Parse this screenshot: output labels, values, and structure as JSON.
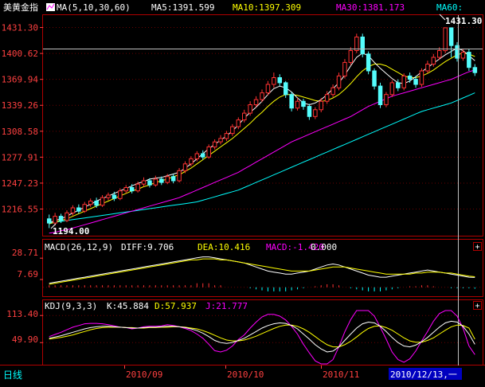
{
  "colors": {
    "background": "#000000",
    "frame": "#b00000",
    "up_candle": "#ff3232",
    "down_candle": "#54fcfc",
    "ma5": "#ffffff",
    "ma10": "#ffff00",
    "ma30": "#ff00ff",
    "ma60": "#00ffff",
    "axis_text": "#ff4040",
    "price_line": "#c0c0c0",
    "macd_pos": "#ff3232",
    "macd_neg": "#00ffff",
    "status_text": "#ffff00",
    "date_highlight": "#0000c0"
  },
  "price_panel": {
    "instrument": "美黄金指",
    "ma_header": "MA(5,10,30,60)",
    "ma5_label": "MA5:1391.599",
    "ma10_label": "MA10:1397.309",
    "ma30_label": "MA30:1381.173",
    "ma60_label": "MA60:",
    "high_marker": "1431.30",
    "low_marker": "1194.00",
    "y_ticks": [
      "1431.30",
      "1400.62",
      "1369.94",
      "1339.26",
      "1308.58",
      "1277.91",
      "1247.23",
      "1216.55"
    ]
  },
  "macd_panel": {
    "header": "MACD(26,12,9)",
    "diff_label": "DIFF:9.706",
    "dea_label": "DEA:10.416",
    "macd_label": "MACD:-1.420",
    "zero_label": "0.000",
    "y_ticks": [
      "28.71",
      "7.69"
    ],
    "plus_button": "+"
  },
  "kdj_panel": {
    "header": "KDJ(9,3,3)",
    "k_label": "K:45.884",
    "d_label": "D:57.937",
    "j_label": "J:21.777",
    "y_ticks": [
      "113.40",
      "49.90"
    ],
    "plus_button": "+"
  },
  "bottom_bar": {
    "period_label": "日线",
    "date_ticks": [
      "2010/09",
      "2010/10",
      "2010/11"
    ],
    "cursor_date": "2010/12/13,一"
  },
  "chart_data": {
    "type": "candlestick",
    "instrument": "美黄金指",
    "ylim": [
      1185,
      1445
    ],
    "date_ticks": [
      "2010/09",
      "2010/10",
      "2010/11"
    ],
    "series": [
      {
        "name": "MA5",
        "values": [
          1200,
          1203,
          1205,
          1208,
          1212,
          1215,
          1219,
          1222,
          1226,
          1229,
          1232,
          1235,
          1238,
          1241,
          1244,
          1247,
          1249,
          1252,
          1253,
          1254,
          1256,
          1258,
          1260,
          1265,
          1270,
          1276,
          1282,
          1288,
          1293,
          1298,
          1303,
          1309,
          1316,
          1324,
          1331,
          1337,
          1344,
          1352,
          1359,
          1362,
          1360,
          1355,
          1348,
          1342,
          1340,
          1342,
          1346,
          1352,
          1359,
          1366,
          1375,
          1386,
          1396,
          1401,
          1398,
          1390,
          1383,
          1377,
          1371,
          1366,
          1365,
          1368,
          1373,
          1379,
          1384,
          1389,
          1394,
          1399,
          1403,
          1407,
          1404,
          1398,
          1392
        ]
      },
      {
        "name": "MA10",
        "values": [
          1199,
          1201,
          1203,
          1205,
          1208,
          1211,
          1214,
          1217,
          1220,
          1223,
          1226,
          1229,
          1232,
          1235,
          1238,
          1240,
          1243,
          1245,
          1248,
          1250,
          1252,
          1255,
          1257,
          1261,
          1265,
          1270,
          1275,
          1280,
          1285,
          1290,
          1295,
          1300,
          1306,
          1312,
          1318,
          1325,
          1331,
          1338,
          1344,
          1349,
          1352,
          1352,
          1351,
          1349,
          1347,
          1345,
          1344,
          1345,
          1348,
          1352,
          1358,
          1365,
          1373,
          1380,
          1385,
          1388,
          1388,
          1386,
          1382,
          1378,
          1374,
          1372,
          1372,
          1374,
          1377,
          1381,
          1386,
          1391,
          1395,
          1399,
          1401,
          1400,
          1397
        ]
      },
      {
        "name": "MA30",
        "values": [
          1188,
          1189,
          1191,
          1192,
          1194,
          1196,
          1198,
          1200,
          1202,
          1204,
          1206,
          1208,
          1210,
          1212,
          1214,
          1216,
          1218,
          1220,
          1222,
          1224,
          1226,
          1228,
          1230,
          1233,
          1236,
          1239,
          1242,
          1245,
          1248,
          1251,
          1254,
          1257,
          1260,
          1264,
          1268,
          1272,
          1276,
          1280,
          1284,
          1288,
          1292,
          1296,
          1299,
          1302,
          1305,
          1308,
          1311,
          1314,
          1317,
          1320,
          1323,
          1326,
          1330,
          1334,
          1338,
          1341,
          1344,
          1347,
          1350,
          1352,
          1354,
          1356,
          1358,
          1360,
          1362,
          1364,
          1366,
          1368,
          1370,
          1373,
          1376,
          1379,
          1381
        ]
      },
      {
        "name": "MA60",
        "values": [
          1200,
          1201,
          1202,
          1203,
          1204,
          1205,
          1206,
          1207,
          1208,
          1209,
          1210,
          1211,
          1212,
          1213,
          1214,
          1215,
          1216,
          1217,
          1218,
          1219,
          1220,
          1221,
          1222,
          1223,
          1224,
          1225,
          1227,
          1229,
          1231,
          1233,
          1235,
          1237,
          1239,
          1242,
          1245,
          1248,
          1251,
          1254,
          1257,
          1260,
          1263,
          1266,
          1269,
          1272,
          1275,
          1278,
          1281,
          1284,
          1287,
          1290,
          1293,
          1296,
          1299,
          1302,
          1305,
          1308,
          1311,
          1314,
          1317,
          1320,
          1323,
          1326,
          1329,
          1332,
          1334,
          1336,
          1338,
          1340,
          1342,
          1345,
          1348,
          1351,
          1354
        ]
      }
    ],
    "candles": [
      {
        "o": 1205,
        "c": 1200,
        "h": 1210,
        "l": 1194
      },
      {
        "o": 1200,
        "c": 1208,
        "h": 1212,
        "l": 1197
      },
      {
        "o": 1208,
        "c": 1203,
        "h": 1211,
        "l": 1200
      },
      {
        "o": 1203,
        "c": 1212,
        "h": 1215,
        "l": 1201
      },
      {
        "o": 1212,
        "c": 1218,
        "h": 1221,
        "l": 1209
      },
      {
        "o": 1218,
        "c": 1214,
        "h": 1222,
        "l": 1211
      },
      {
        "o": 1214,
        "c": 1222,
        "h": 1225,
        "l": 1212
      },
      {
        "o": 1222,
        "c": 1226,
        "h": 1229,
        "l": 1219
      },
      {
        "o": 1226,
        "c": 1221,
        "h": 1230,
        "l": 1218
      },
      {
        "o": 1221,
        "c": 1230,
        "h": 1233,
        "l": 1219
      },
      {
        "o": 1230,
        "c": 1233,
        "h": 1236,
        "l": 1227
      },
      {
        "o": 1233,
        "c": 1229,
        "h": 1237,
        "l": 1226
      },
      {
        "o": 1229,
        "c": 1238,
        "h": 1241,
        "l": 1227
      },
      {
        "o": 1238,
        "c": 1242,
        "h": 1245,
        "l": 1235
      },
      {
        "o": 1242,
        "c": 1238,
        "h": 1246,
        "l": 1235
      },
      {
        "o": 1238,
        "c": 1246,
        "h": 1249,
        "l": 1236
      },
      {
        "o": 1246,
        "c": 1250,
        "h": 1254,
        "l": 1243
      },
      {
        "o": 1250,
        "c": 1245,
        "h": 1253,
        "l": 1242
      },
      {
        "o": 1245,
        "c": 1252,
        "h": 1256,
        "l": 1243
      },
      {
        "o": 1252,
        "c": 1248,
        "h": 1255,
        "l": 1245
      },
      {
        "o": 1248,
        "c": 1255,
        "h": 1258,
        "l": 1246
      },
      {
        "o": 1255,
        "c": 1250,
        "h": 1258,
        "l": 1247
      },
      {
        "o": 1250,
        "c": 1262,
        "h": 1265,
        "l": 1248
      },
      {
        "o": 1262,
        "c": 1270,
        "h": 1273,
        "l": 1259
      },
      {
        "o": 1270,
        "c": 1276,
        "h": 1279,
        "l": 1267
      },
      {
        "o": 1276,
        "c": 1282,
        "h": 1285,
        "l": 1273
      },
      {
        "o": 1282,
        "c": 1278,
        "h": 1286,
        "l": 1275
      },
      {
        "o": 1278,
        "c": 1290,
        "h": 1293,
        "l": 1276
      },
      {
        "o": 1290,
        "c": 1296,
        "h": 1299,
        "l": 1287
      },
      {
        "o": 1296,
        "c": 1300,
        "h": 1304,
        "l": 1293
      },
      {
        "o": 1300,
        "c": 1306,
        "h": 1309,
        "l": 1297
      },
      {
        "o": 1306,
        "c": 1314,
        "h": 1317,
        "l": 1303
      },
      {
        "o": 1314,
        "c": 1322,
        "h": 1325,
        "l": 1311
      },
      {
        "o": 1322,
        "c": 1330,
        "h": 1334,
        "l": 1319
      },
      {
        "o": 1330,
        "c": 1340,
        "h": 1344,
        "l": 1327
      },
      {
        "o": 1340,
        "c": 1346,
        "h": 1350,
        "l": 1337
      },
      {
        "o": 1346,
        "c": 1354,
        "h": 1358,
        "l": 1343
      },
      {
        "o": 1354,
        "c": 1364,
        "h": 1368,
        "l": 1351
      },
      {
        "o": 1364,
        "c": 1372,
        "h": 1378,
        "l": 1360
      },
      {
        "o": 1372,
        "c": 1366,
        "h": 1376,
        "l": 1362
      },
      {
        "o": 1366,
        "c": 1352,
        "h": 1368,
        "l": 1348
      },
      {
        "o": 1352,
        "c": 1336,
        "h": 1355,
        "l": 1332
      },
      {
        "o": 1336,
        "c": 1344,
        "h": 1348,
        "l": 1333
      },
      {
        "o": 1344,
        "c": 1338,
        "h": 1347,
        "l": 1334
      },
      {
        "o": 1338,
        "c": 1326,
        "h": 1341,
        "l": 1322
      },
      {
        "o": 1326,
        "c": 1334,
        "h": 1337,
        "l": 1323
      },
      {
        "o": 1334,
        "c": 1344,
        "h": 1348,
        "l": 1331
      },
      {
        "o": 1344,
        "c": 1352,
        "h": 1356,
        "l": 1341
      },
      {
        "o": 1352,
        "c": 1360,
        "h": 1364,
        "l": 1349
      },
      {
        "o": 1360,
        "c": 1374,
        "h": 1378,
        "l": 1357
      },
      {
        "o": 1374,
        "c": 1390,
        "h": 1394,
        "l": 1371
      },
      {
        "o": 1390,
        "c": 1404,
        "h": 1408,
        "l": 1387
      },
      {
        "o": 1404,
        "c": 1420,
        "h": 1424,
        "l": 1401
      },
      {
        "o": 1420,
        "c": 1400,
        "h": 1424,
        "l": 1396
      },
      {
        "o": 1400,
        "c": 1380,
        "h": 1403,
        "l": 1376
      },
      {
        "o": 1380,
        "c": 1362,
        "h": 1383,
        "l": 1358
      },
      {
        "o": 1362,
        "c": 1340,
        "h": 1366,
        "l": 1336
      },
      {
        "o": 1340,
        "c": 1352,
        "h": 1355,
        "l": 1337
      },
      {
        "o": 1352,
        "c": 1366,
        "h": 1369,
        "l": 1349
      },
      {
        "o": 1366,
        "c": 1360,
        "h": 1370,
        "l": 1356
      },
      {
        "o": 1360,
        "c": 1374,
        "h": 1377,
        "l": 1357
      },
      {
        "o": 1374,
        "c": 1370,
        "h": 1378,
        "l": 1366
      },
      {
        "o": 1370,
        "c": 1364,
        "h": 1374,
        "l": 1360
      },
      {
        "o": 1364,
        "c": 1380,
        "h": 1383,
        "l": 1361
      },
      {
        "o": 1380,
        "c": 1388,
        "h": 1392,
        "l": 1377
      },
      {
        "o": 1388,
        "c": 1396,
        "h": 1400,
        "l": 1385
      },
      {
        "o": 1396,
        "c": 1404,
        "h": 1408,
        "l": 1393
      },
      {
        "o": 1404,
        "c": 1431,
        "h": 1431,
        "l": 1401
      },
      {
        "o": 1431,
        "c": 1410,
        "h": 1431,
        "l": 1396
      },
      {
        "o": 1410,
        "c": 1395,
        "h": 1414,
        "l": 1391
      },
      {
        "o": 1395,
        "c": 1402,
        "h": 1406,
        "l": 1392
      },
      {
        "o": 1402,
        "c": 1384,
        "h": 1406,
        "l": 1380
      },
      {
        "o": 1384,
        "c": 1378,
        "h": 1388,
        "l": 1374
      }
    ],
    "macd": {
      "ylim": [
        -8,
        32
      ],
      "diff": [
        4,
        5,
        6,
        7,
        8,
        9,
        10,
        11,
        12,
        13,
        14,
        15,
        16,
        17,
        18,
        19,
        20,
        21,
        22,
        23,
        24,
        25,
        26,
        27,
        28,
        29,
        30,
        30,
        29,
        28,
        27,
        26,
        25,
        24,
        22,
        20,
        18,
        16,
        15,
        14,
        13,
        13,
        14,
        15,
        16,
        18,
        20,
        22,
        23,
        22,
        20,
        18,
        16,
        14,
        12,
        11,
        10,
        10,
        11,
        12,
        13,
        14,
        15,
        16,
        17,
        16,
        15,
        14,
        13,
        12,
        11,
        10,
        9.7
      ],
      "dea": [
        3,
        4,
        5,
        6,
        7,
        8,
        9,
        10,
        11,
        12,
        13,
        14,
        15,
        16,
        17,
        18,
        19,
        20,
        21,
        22,
        23,
        24,
        25,
        26,
        27,
        27,
        28,
        28,
        28,
        27,
        27,
        26,
        25,
        24,
        23,
        22,
        21,
        20,
        19,
        18,
        17,
        16,
        16,
        16,
        16,
        17,
        18,
        19,
        20,
        20,
        20,
        19,
        18,
        17,
        16,
        15,
        14,
        13,
        13,
        13,
        13,
        13,
        14,
        14,
        15,
        15,
        15,
        14,
        14,
        13,
        12,
        11,
        10.4
      ],
      "hist": [
        2,
        2,
        2,
        2,
        2,
        2,
        2,
        2,
        2,
        2,
        2,
        2,
        2,
        2,
        2,
        2,
        2,
        2,
        2,
        2,
        2,
        2,
        2,
        2,
        2,
        4,
        4,
        4,
        2,
        2,
        0,
        0,
        0,
        0,
        -1,
        -2,
        -3,
        -4,
        -4,
        -4,
        -4,
        -3,
        -2,
        -1,
        0,
        1,
        2,
        3,
        3,
        2,
        0,
        -1,
        -2,
        -3,
        -4,
        -4,
        -4,
        -3,
        -2,
        -1,
        0,
        1,
        1,
        2,
        2,
        1,
        0,
        0,
        -1,
        -1,
        -1,
        -1,
        -1.4
      ]
    },
    "kdj": {
      "ylim": [
        0,
        125
      ],
      "k": [
        60,
        63,
        66,
        70,
        74,
        78,
        82,
        85,
        87,
        88,
        88,
        87,
        86,
        85,
        84,
        84,
        85,
        86,
        86,
        87,
        88,
        88,
        87,
        85,
        82,
        78,
        72,
        64,
        55,
        50,
        48,
        50,
        55,
        60,
        68,
        76,
        84,
        90,
        94,
        96,
        95,
        90,
        82,
        70,
        58,
        45,
        35,
        28,
        30,
        40,
        55,
        70,
        84,
        94,
        98,
        96,
        88,
        76,
        62,
        50,
        42,
        40,
        44,
        52,
        62,
        74,
        86,
        96,
        100,
        98,
        88,
        70,
        45.9
      ],
      "d": [
        58,
        60,
        62,
        65,
        68,
        72,
        76,
        80,
        83,
        85,
        86,
        86,
        86,
        85,
        85,
        84,
        84,
        85,
        85,
        86,
        86,
        87,
        87,
        86,
        84,
        82,
        78,
        73,
        67,
        61,
        56,
        54,
        54,
        56,
        60,
        65,
        71,
        77,
        83,
        88,
        91,
        91,
        88,
        82,
        74,
        64,
        54,
        45,
        40,
        40,
        45,
        53,
        63,
        74,
        83,
        88,
        89,
        85,
        79,
        70,
        61,
        54,
        51,
        51,
        55,
        61,
        70,
        79,
        87,
        91,
        90,
        84,
        57.9
      ],
      "j": [
        64,
        69,
        74,
        80,
        86,
        90,
        94,
        95,
        95,
        94,
        92,
        89,
        86,
        85,
        82,
        84,
        87,
        88,
        88,
        89,
        92,
        90,
        87,
        83,
        78,
        70,
        60,
        46,
        31,
        28,
        32,
        42,
        57,
        68,
        84,
        98,
        110,
        116,
        116,
        112,
        103,
        88,
        70,
        46,
        26,
        7,
        0,
        0,
        10,
        40,
        75,
        104,
        126,
        126,
        126,
        112,
        86,
        58,
        28,
        10,
        4,
        12,
        30,
        54,
        76,
        100,
        118,
        126,
        126,
        112,
        84,
        42,
        21.8
      ]
    }
  }
}
